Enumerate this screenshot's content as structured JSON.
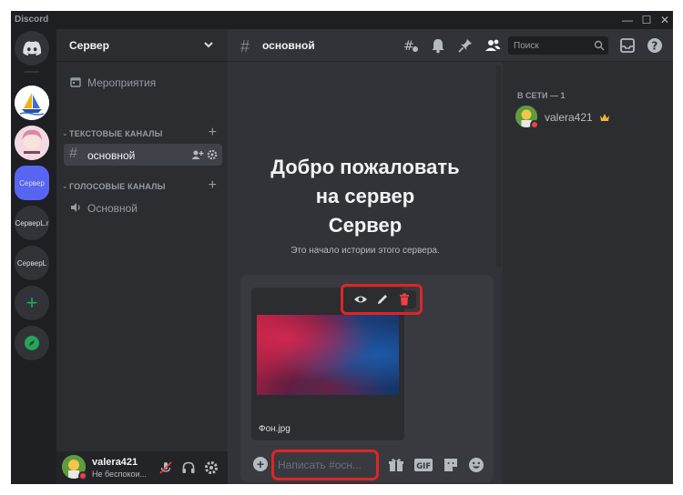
{
  "app": {
    "title": "Discord"
  },
  "servers": [
    {
      "label": "",
      "icon": "discord-home-icon"
    },
    {
      "label": "",
      "icon": "ship-avatar"
    },
    {
      "label": "",
      "icon": "anime-avatar"
    },
    {
      "label": "Сервер",
      "icon": "server-selected"
    },
    {
      "label": "СерверL.r",
      "icon": "server"
    },
    {
      "label": "СерверL",
      "icon": "server"
    },
    {
      "label": "",
      "icon": "plus-icon"
    },
    {
      "label": "",
      "icon": "compass-icon"
    }
  ],
  "sidebar": {
    "server_name": "Сервер",
    "events_label": "Мероприятия",
    "text_category": "ТЕКСТОВЫЕ КАНАЛЫ",
    "text_channel": "основной",
    "voice_category": "ГОЛОСОВЫЕ КАНАЛЫ",
    "voice_channel": "Основной"
  },
  "user": {
    "name": "valera421",
    "status": "Не беспокои..."
  },
  "channel": {
    "name": "основной"
  },
  "welcome": {
    "line1": "Добро пожаловать",
    "line2": "на сервер",
    "line3": "Сервер",
    "subtitle": "Это начало истории этого сервера."
  },
  "attachment": {
    "filename": "Фон.jpg"
  },
  "composer": {
    "placeholder": "Написать #осн..."
  },
  "members": {
    "search_placeholder": "Поиск",
    "online_header": "В СЕТИ — 1",
    "member_name": "valera421"
  },
  "colors": {
    "accent": "#5865f2",
    "highlight": "#e02424",
    "dnd": "#f23f43",
    "green": "#23a55a"
  }
}
